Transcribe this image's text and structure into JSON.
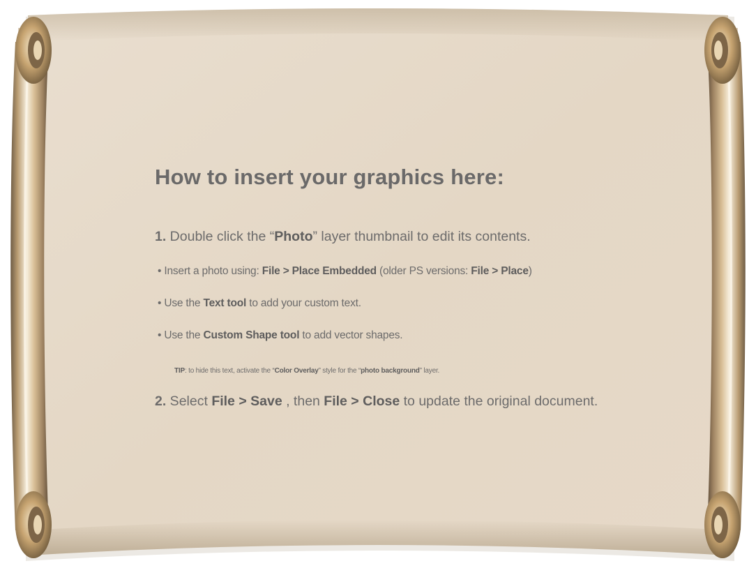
{
  "heading": "How to insert your graphics here:",
  "step1": {
    "number": "1.",
    "text_a": " Double click the “",
    "bold_a": "Photo",
    "text_b": "” layer thumbnail to edit its contents."
  },
  "bullets": [
    {
      "prefix": "• Insert a photo using: ",
      "bold_a": "File > Place Embedded",
      "mid": " (older PS versions: ",
      "bold_b": "File > Place",
      "suffix": ")"
    },
    {
      "prefix": "• Use the ",
      "bold_a": "Text tool",
      "suffix": " to add your custom text."
    },
    {
      "prefix": "• Use the ",
      "bold_a": "Custom Shape tool",
      "suffix": " to add vector shapes."
    }
  ],
  "tip": {
    "label": "TIP",
    "text_a": ": to hide this text, activate the “",
    "bold_a": "Color Overlay",
    "text_b": "” style for the “",
    "bold_b": "photo background",
    "text_c": "” layer."
  },
  "step2": {
    "number": "2.",
    "text_a": " Select ",
    "bold_a": "File > Save",
    "text_b": " , then ",
    "bold_b": "File > Close",
    "text_c": " to update the original document."
  },
  "colors": {
    "parchment": "#e4d7c6",
    "text": "#6c6b6b",
    "rod_gold": "#c9ac82",
    "rod_highlight": "#f6ecd9"
  }
}
